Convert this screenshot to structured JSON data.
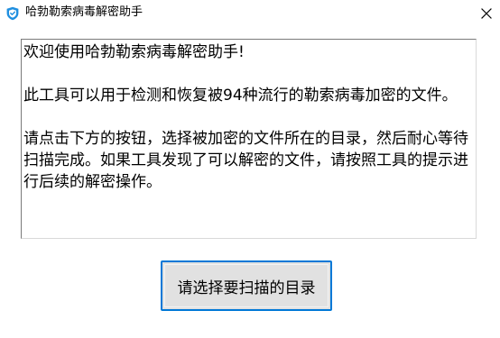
{
  "window": {
    "title": "哈勃勒索病毒解密助手",
    "icon": "shield-app-icon",
    "close_icon": "close-icon",
    "accent_color": "#0078d7"
  },
  "description": {
    "paragraph1": "欢迎使用哈勃勒索病毒解密助手!",
    "paragraph2": "此工具可以用于检测和恢复被94种流行的勒索病毒加密的文件。",
    "paragraph3": "请点击下方的按钮，选择被加密的文件所在的目录，然后耐心等待扫描完成。如果工具发现了可以解密的文件，请按照工具的提示进行后续的解密操作。"
  },
  "actions": {
    "scan_button_label": "请选择要扫描的目录"
  }
}
